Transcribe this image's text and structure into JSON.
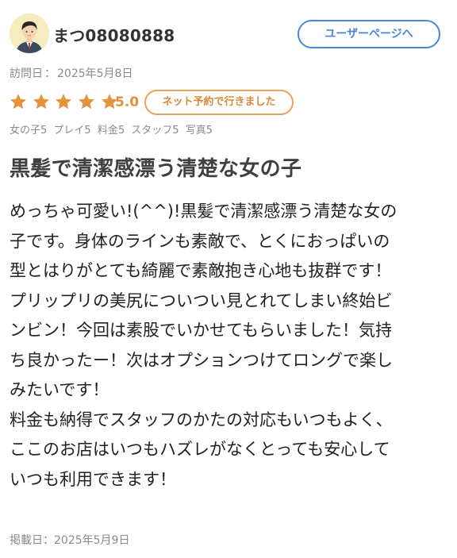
{
  "user": {
    "name": "まつ08080888",
    "user_page_button": "ユーザーページへ"
  },
  "review": {
    "visit_label": "訪問日",
    "visit_date": "2025年5月8日",
    "stars": 5,
    "score": "5.0",
    "badge": "ネット予約で行きました",
    "sub_scores": [
      "女の子5",
      "プレイ5",
      "料金5",
      "スタッフ5",
      "写真5"
    ],
    "title": "黒髪で清潔感漂う清楚な女の子",
    "body_lines": [
      "めっちゃ可愛い!(^^)!黒髪で清潔感漂う清楚な女の",
      "子です。身体のラインも素敵で、とくにおっぱいの",
      "型とはりがとても綺麗で素敵抱き心地も抜群です！",
      "プリップリの美尻についつい見とれてしまい終始ビ",
      "ンビン！今回は素股でいかせてもらいました！気持",
      "ち良かったー！次はオプションつけてロングで楽し",
      "みたいです！",
      "料金も納得でスタッフのかたの対応もいつもよく、",
      "ここのお店はいつもハズレがなくとっても安心して",
      "いつも利用できます！"
    ],
    "post_label": "掲載日",
    "post_date": "2025年5月9日"
  },
  "colors": {
    "star": "#e6913b",
    "accent_blue": "#4a86d8",
    "badge_orange": "#e3a55d",
    "muted_text": "#8a8a8a"
  }
}
